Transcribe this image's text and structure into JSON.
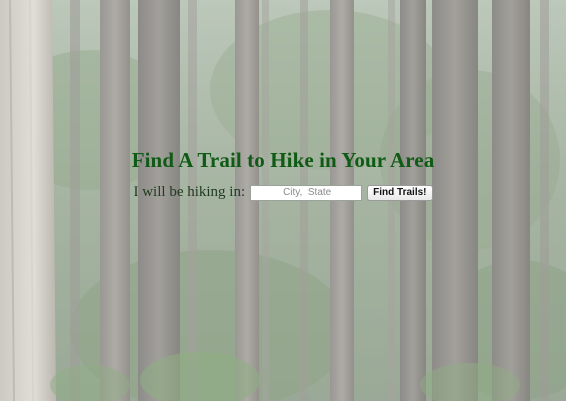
{
  "hero": {
    "title": "Find A Trail to Hike in Your Area"
  },
  "search": {
    "label": "I will be hiking in:",
    "placeholder": "City,  State",
    "value": "",
    "button_label": "Find Trails!"
  },
  "colors": {
    "title": "#0f5a14",
    "background_tint": "#8f9c8d"
  }
}
